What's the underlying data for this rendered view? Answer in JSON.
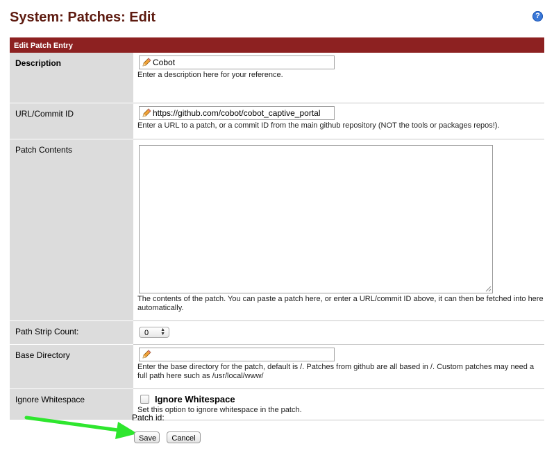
{
  "header": {
    "title": "System: Patches: Edit",
    "help_icon": "?"
  },
  "section": {
    "title": "Edit Patch Entry",
    "accent_color": "#8d2121"
  },
  "fields": {
    "description": {
      "label": "Description",
      "value": "Cobot",
      "hint": "Enter a description here for your reference."
    },
    "url": {
      "label": "URL/Commit ID",
      "value": "https://github.com/cobot/cobot_captive_portal",
      "hint": "Enter a URL to a patch, or a commit ID from the main github repository (NOT the tools or packages repos!)."
    },
    "patch_contents": {
      "label": "Patch Contents",
      "value": "",
      "hint": "The contents of the patch. You can paste a patch here, or enter a URL/commit ID above, it can then be fetched into here automatically."
    },
    "strip_count": {
      "label": "Path Strip Count:",
      "value": "0"
    },
    "base_directory": {
      "label": "Base Directory",
      "value": "",
      "hint": "Enter the base directory for the patch, default is /. Patches from github are all based in /. Custom patches may need a full path here such as /usr/local/www/"
    },
    "ignore_whitespace": {
      "label": "Ignore Whitespace",
      "checkbox_label": "Ignore Whitespace",
      "checked": false,
      "hint": "Set this option to ignore whitespace in the patch."
    }
  },
  "footer": {
    "patch_id_label": "Patch id:",
    "save_label": "Save",
    "cancel_label": "Cancel"
  },
  "annotation": {
    "arrow_color": "#2ee62e",
    "arrow_icon": "green-arrow-icon"
  }
}
